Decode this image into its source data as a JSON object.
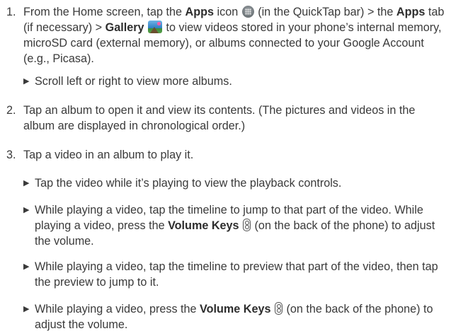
{
  "steps": [
    {
      "num": "1.",
      "t1": "From the Home screen, tap the ",
      "b1": "Apps",
      "t2": " icon ",
      "t3": " (in the QuickTap bar) > the ",
      "b2": "Apps",
      "t4": " tab (if necessary) > ",
      "b3": "Gallery",
      "t5": " to view videos stored in your phone’s internal memory, microSD card (external memory), or albums connected to your Google Account (e.g., Picasa)."
    },
    {
      "num": "2.",
      "text": "Tap an album to open it and view its contents. (The pictures and videos in the album are displayed in chronological order.)"
    },
    {
      "num": "3.",
      "text": "Tap a video in an album to play it."
    }
  ],
  "bullets": [
    {
      "text": "Scroll left or right to view more albums."
    },
    {
      "text": "Tap the video while it’s playing to view the playback controls."
    },
    {
      "t1": "While playing a video, tap the timeline to jump to that part of the video. While playing a video, press the ",
      "b1": "Volume Keys",
      "t2": " (on the back of the phone) to adjust the volume."
    },
    {
      "text": "While playing a video, tap the timeline to preview that part of the video, then tap the preview to jump to it."
    },
    {
      "t1": "While playing a video, press the ",
      "b1": "Volume Keys",
      "t2": " (on the back of the phone) to adjust the volume."
    }
  ],
  "bullet_glyph": "▶",
  "icons": {
    "apps": "apps-icon",
    "gallery": "gallery-icon",
    "volume": "volume-keys-icon"
  }
}
